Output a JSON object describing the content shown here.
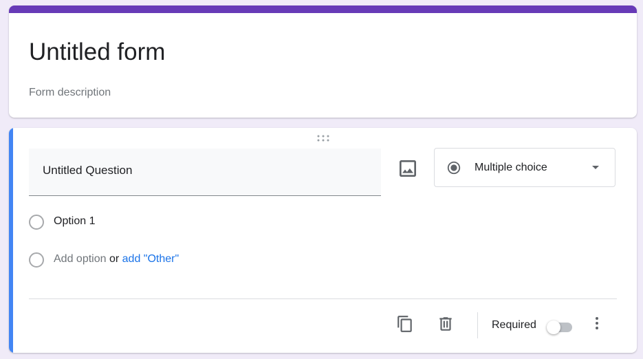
{
  "form": {
    "title": "Untitled form",
    "description_placeholder": "Form description",
    "accent_color": "#673ab7"
  },
  "question": {
    "title": "Untitled Question",
    "type_label": "Multiple choice",
    "options": [
      "Option 1"
    ],
    "add_option_label": "Add option",
    "or_label": "or",
    "add_other_label": "add \"Other\"",
    "required_label": "Required",
    "required_on": false,
    "accent_color": "#4285f4"
  },
  "icons": {
    "drag": "drag-handle-icon",
    "image": "image-icon",
    "type": "radio-button-icon",
    "caret": "caret-down-icon",
    "duplicate": "copy-icon",
    "delete": "trash-icon",
    "more": "more-vert-icon"
  }
}
